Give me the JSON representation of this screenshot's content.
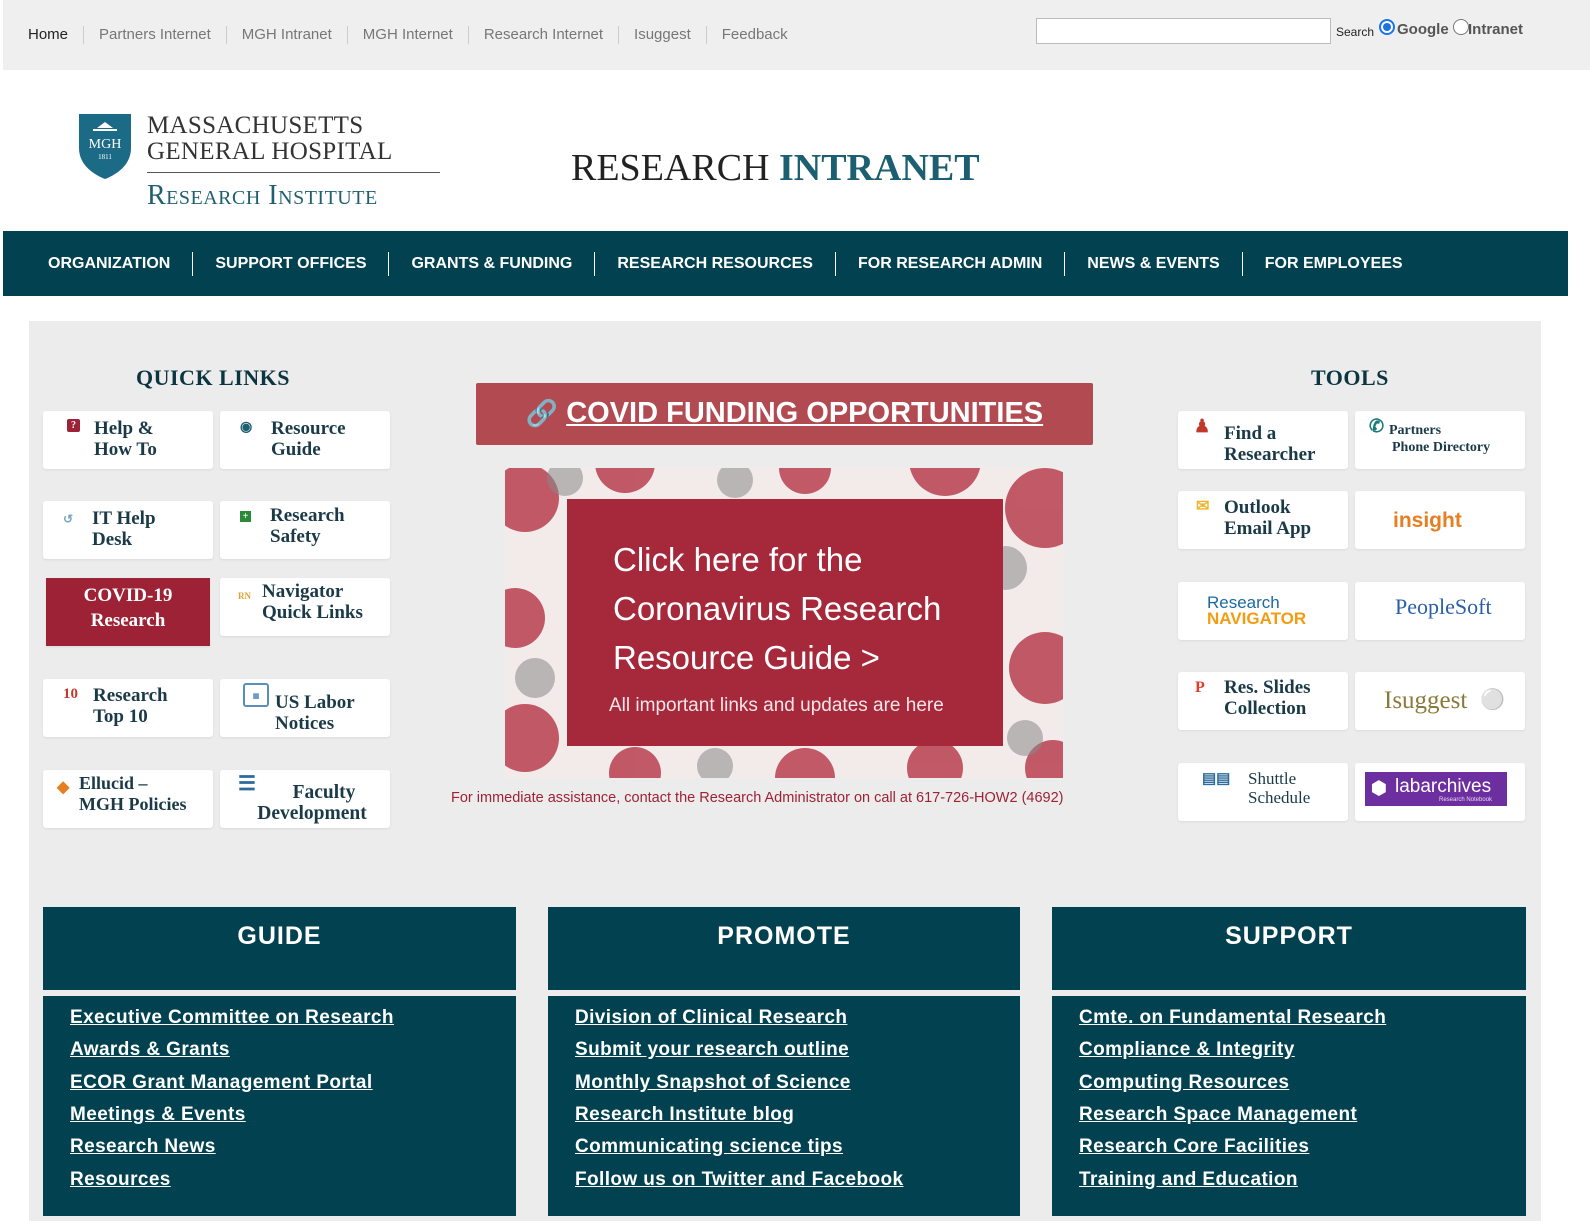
{
  "topbar": {
    "links": [
      "Home",
      "Partners Internet",
      "MGH Intranet",
      "MGH Internet",
      "Research Internet",
      "Isuggest",
      "Feedback"
    ],
    "search_label": "Search",
    "radio_google": "Google",
    "radio_intranet": "Intranet"
  },
  "logo": {
    "shield_text": "MGH",
    "shield_year": "1811",
    "line1": "MASSACHUSETTS",
    "line2": "GENERAL HOSPITAL",
    "line3": "Research Institute"
  },
  "site_title": {
    "part1": "RESEARCH",
    "part2": "INTRANET"
  },
  "nav": [
    "ORGANIZATION",
    "SUPPORT OFFICES",
    "GRANTS & FUNDING",
    "RESEARCH RESOURCES",
    "FOR RESEARCH ADMIN",
    "NEWS & EVENTS",
    "FOR EMPLOYEES"
  ],
  "quick_links": {
    "title": "QUICK LINKS",
    "items": [
      {
        "l1": "Help &",
        "l2": "How To"
      },
      {
        "l1": "Resource",
        "l2": "Guide"
      },
      {
        "l1": "IT Help",
        "l2": "Desk"
      },
      {
        "l1": "Research",
        "l2": "Safety"
      },
      {
        "l1": "COVID-19",
        "l2": "Research"
      },
      {
        "l1": "Navigator",
        "l2": "Quick Links"
      },
      {
        "l1": "Research",
        "l2": "Top 10"
      },
      {
        "l1": "US Labor",
        "l2": "Notices"
      },
      {
        "l1": "Ellucid –",
        "l2": "MGH Policies"
      },
      {
        "l1": "Faculty",
        "l2": "Development"
      }
    ]
  },
  "covid": {
    "button": "COVID FUNDING OPPORTUNITIES",
    "banner_l1": "Click here for the",
    "banner_l2": "Coronavirus Research",
    "banner_l3": "Resource Guide >",
    "banner_sub": "All important links and updates are here",
    "contact": "For immediate assistance, contact the Research Administrator on call at 617-726-HOW2 (4692)"
  },
  "tools": {
    "title": "TOOLS",
    "items": [
      {
        "l1": "Find a",
        "l2": "Researcher"
      },
      {
        "l1": "Partners",
        "l2": "Phone Directory"
      },
      {
        "l1": "Outlook",
        "l2": "Email App"
      },
      {
        "l1": "insight",
        "l2": ""
      },
      {
        "l1": "Research",
        "l2": "NAVIGATOR"
      },
      {
        "l1": "PeopleSoft",
        "l2": ""
      },
      {
        "l1": "Res. Slides",
        "l2": "Collection"
      },
      {
        "l1": "Isuggest",
        "l2": ""
      },
      {
        "l1": "Shuttle",
        "l2": "Schedule"
      },
      {
        "l1": "labarchives",
        "l2": "Research Notebook"
      }
    ]
  },
  "columns": [
    {
      "title": "GUIDE",
      "links": [
        "Executive Committee on Research",
        "Awards & Grants ",
        "ECOR Grant Management Portal",
        "Meetings & Events ",
        "Research News ",
        "Resources"
      ]
    },
    {
      "title": "PROMOTE",
      "links": [
        "Division of Clinical Research",
        "Submit your research outline",
        "Monthly Snapshot of Science",
        "Research Institute blog",
        "Communicating science tips ",
        "Follow us on Twitter  and  Facebook"
      ]
    },
    {
      "title": "SUPPORT",
      "links": [
        "Cmte. on Fundamental Research ",
        "Compliance & Integrity",
        "Computing Resources",
        "Research Space Management",
        "Research Core Facilities",
        "Training and Education"
      ]
    }
  ],
  "colors": {
    "nav_bg": "#024250",
    "covid_red": "#9d2235",
    "button_red": "#b14a51",
    "title_teal": "#1b5f71"
  }
}
